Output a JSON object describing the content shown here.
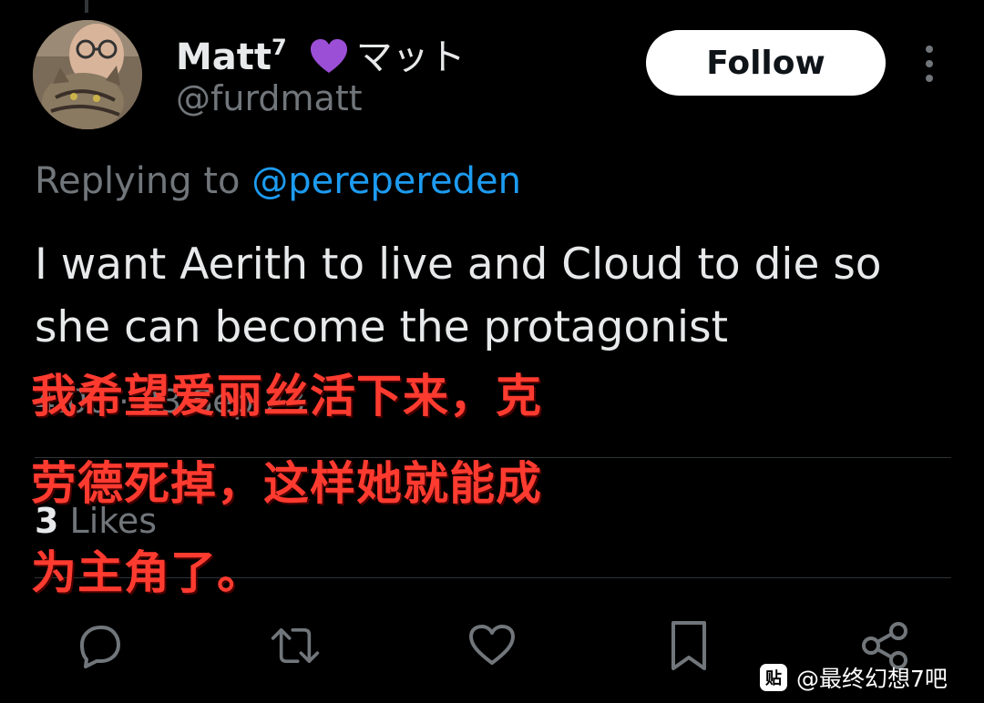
{
  "author": {
    "display_name": "Matt",
    "superscript": "7",
    "katakana": "マット",
    "handle": "@furdmatt"
  },
  "follow_label": "Follow",
  "reply": {
    "prefix": "Replying to ",
    "target": "@perepereden"
  },
  "tweet_text": "I want Aerith to live and Cloud to die so she can become the protagonist",
  "meta_partial": "4:00 · 23 Sep 23",
  "likes": {
    "count": "3",
    "label": " Likes"
  },
  "overlay_lines": [
    "我希望爱丽丝活下来，克",
    "劳德死掉，这样她就能成",
    "为主角了。"
  ],
  "actions": [
    "reply-icon",
    "retweet-icon",
    "like-icon",
    "bookmark-icon",
    "share-icon"
  ],
  "watermark": {
    "icon_text": "贴",
    "text": "@最终幻想7吧"
  },
  "colors": {
    "background": "#000000",
    "link": "#1d9bf0",
    "muted": "#71767b",
    "overlay": "#ff3b30",
    "heart": "#9b4fd6"
  }
}
